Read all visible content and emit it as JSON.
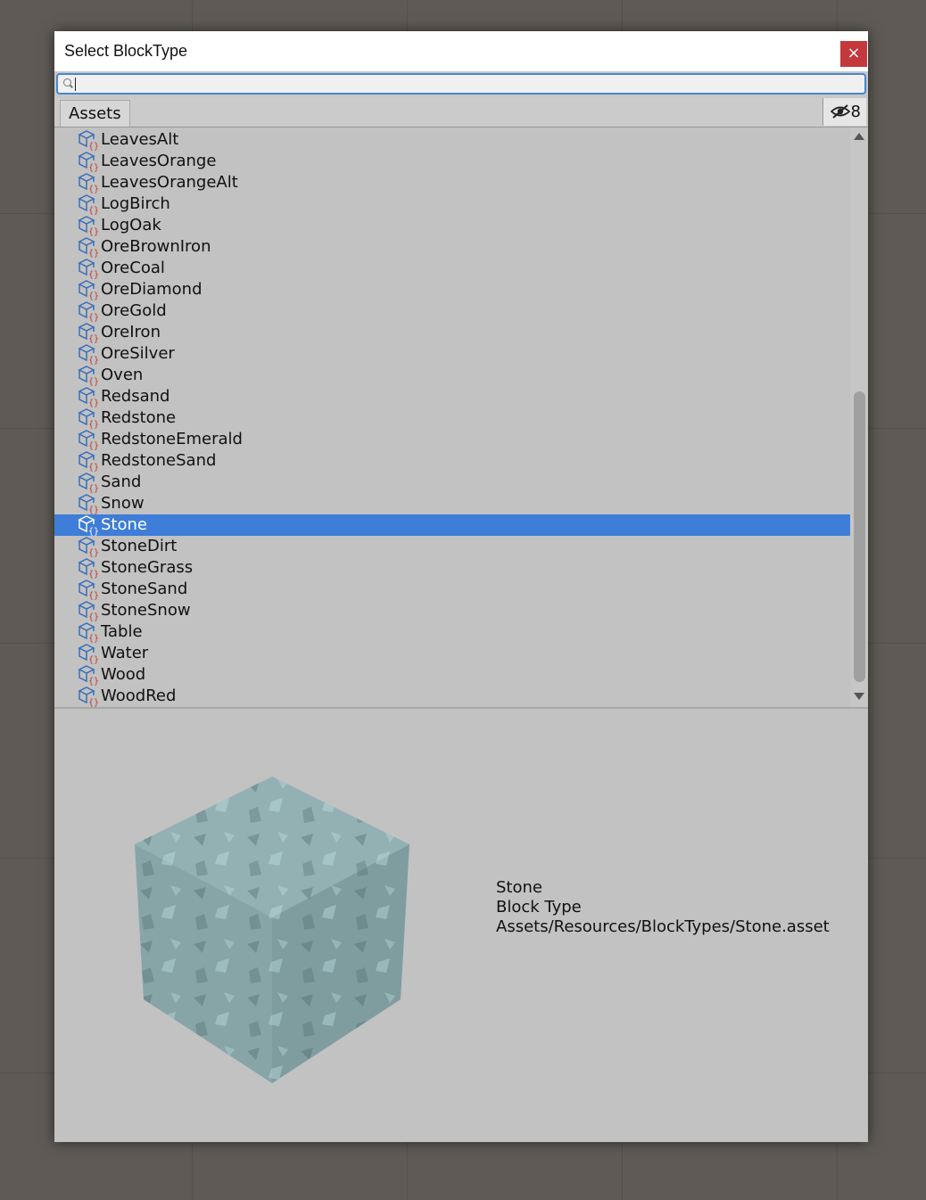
{
  "dialog": {
    "title": "Select BlockType",
    "close_label": "×"
  },
  "search": {
    "value": "",
    "placeholder": ""
  },
  "tabs": {
    "assets_label": "Assets",
    "hidden_count": "8"
  },
  "list": {
    "items": [
      "LeavesAlt",
      "LeavesOrange",
      "LeavesOrangeAlt",
      "LogBirch",
      "LogOak",
      "OreBrownIron",
      "OreCoal",
      "OreDiamond",
      "OreGold",
      "OreIron",
      "OreSilver",
      "Oven",
      "Redsand",
      "Redstone",
      "RedstoneEmerald",
      "RedstoneSand",
      "Sand",
      "Snow",
      "Stone",
      "StoneDirt",
      "StoneGrass",
      "StoneSand",
      "StoneSnow",
      "Table",
      "Water",
      "Wood",
      "WoodRed"
    ],
    "selected": "Stone",
    "icon": "scriptable-object-icon"
  },
  "preview": {
    "name": "Stone",
    "type": "Block Type",
    "path": "Assets/Resources/BlockTypes/Stone.asset",
    "cube_color": "#8aa8aa",
    "icon": "stone-block-preview"
  },
  "colors": {
    "selection": "#3e7dd8",
    "close_button": "#c5383b",
    "search_focus": "#4a87c9"
  }
}
